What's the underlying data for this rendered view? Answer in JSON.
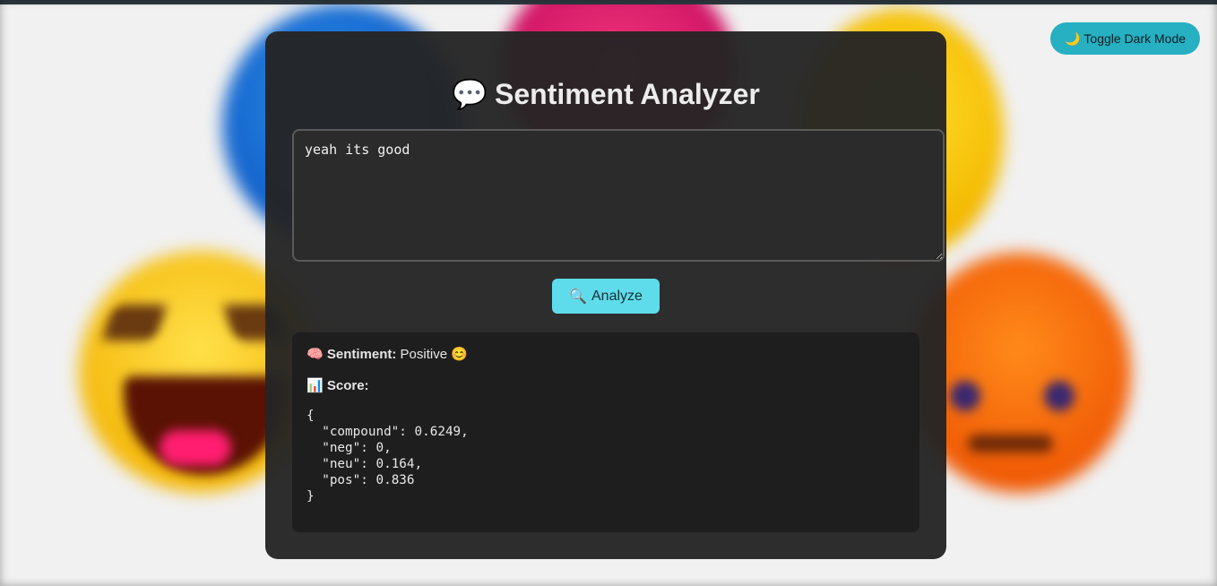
{
  "toggle": {
    "icon": "🌙",
    "label": "Toggle Dark Mode"
  },
  "header": {
    "icon": "💬",
    "title": "Sentiment Analyzer"
  },
  "input": {
    "value": "yeah its good"
  },
  "analyze": {
    "icon": "🔍",
    "label": "Analyze"
  },
  "result": {
    "sentiment_icon": "🧠",
    "sentiment_label": "Sentiment:",
    "sentiment_value": "Positive",
    "sentiment_emoji": "😊",
    "score_icon": "📊",
    "score_label": "Score:",
    "scores": {
      "compound": "0.6249",
      "neg": "0",
      "neu": "0.164",
      "pos": "0.836"
    }
  },
  "colors": {
    "accent": "#5fdceb",
    "toggle": "#26b0c2",
    "card": "#242424",
    "result_bg": "#1e1e1e"
  }
}
